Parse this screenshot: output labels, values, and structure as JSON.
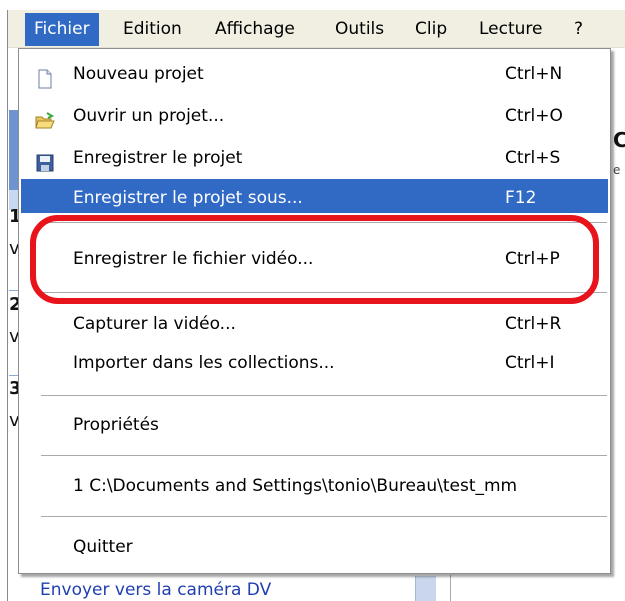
{
  "menubar": {
    "items": [
      {
        "label": "Fichier",
        "active": true
      },
      {
        "label": "Edition"
      },
      {
        "label": "Affichage"
      },
      {
        "label": "Outils"
      },
      {
        "label": "Clip"
      },
      {
        "label": "Lecture"
      },
      {
        "label": "?"
      }
    ]
  },
  "fichier_menu": {
    "items": [
      {
        "label": "Nouveau projet",
        "shortcut": "Ctrl+N",
        "icon": "new-project-icon"
      },
      {
        "label": "Ouvrir un projet...",
        "shortcut": "Ctrl+O",
        "icon": "open-folder-icon"
      },
      {
        "label": "Enregistrer le projet",
        "shortcut": "Ctrl+S",
        "icon": "save-disk-icon"
      },
      {
        "label": "Enregistrer le projet sous...",
        "shortcut": "F12",
        "selected": true
      },
      {
        "label": "Enregistrer le fichier vidéo...",
        "shortcut": "Ctrl+P",
        "highlighted": true
      },
      {
        "label": "Capturer la vidéo...",
        "shortcut": "Ctrl+R"
      },
      {
        "label": "Importer dans les collections...",
        "shortcut": "Ctrl+I"
      },
      {
        "label": "Propriétés",
        "shortcut": ""
      },
      {
        "label": "1 C:\\Documents and Settings\\tonio\\Bureau\\test_mm",
        "shortcut": ""
      },
      {
        "label": "Quitter",
        "shortcut": ""
      }
    ]
  },
  "background": {
    "left_markers": [
      "1",
      "v",
      "2",
      "v",
      "3",
      "v"
    ],
    "right_fragment": "C",
    "right_dot": "e",
    "bottom_link": "Envoyer vers la caméra DV"
  },
  "colors": {
    "menubar_bg": "#f1efe2",
    "selection_blue": "#316ac5",
    "annotation_red": "#e8141c"
  }
}
